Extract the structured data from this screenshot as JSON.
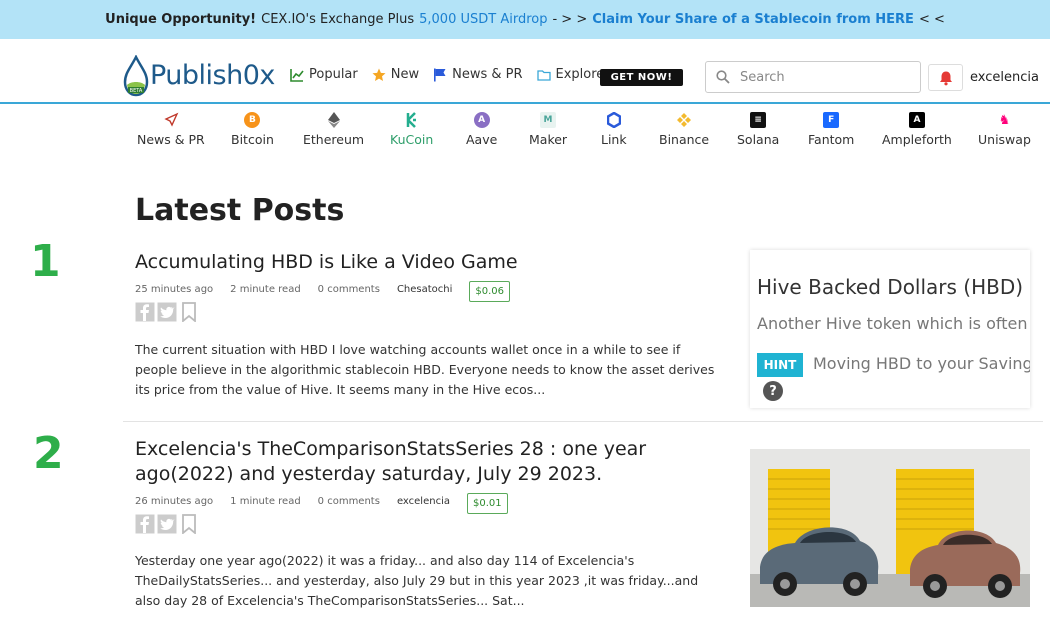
{
  "banner": {
    "bold": "Unique Opportunity!",
    "text": "CEX.IO's Exchange Plus",
    "highlight": "5,000 USDT Airdrop",
    "arrows": "- > >",
    "cta": "Claim Your Share of a Stablecoin from HERE",
    "end": "< <"
  },
  "header": {
    "logo": "Publish0x",
    "nav": [
      {
        "label": "Popular",
        "icon": "chart-icon"
      },
      {
        "label": "New",
        "icon": "star-icon"
      },
      {
        "label": "News & PR",
        "icon": "flag-icon"
      },
      {
        "label": "Explore",
        "icon": "folder-icon"
      }
    ],
    "get_now": "GET NOW!",
    "search_placeholder": "Search",
    "username": "excelencia"
  },
  "coins": [
    {
      "label": "News & PR",
      "color": "#c0392b"
    },
    {
      "label": "Bitcoin",
      "color": "#f7931a"
    },
    {
      "label": "Ethereum",
      "color": "#444444"
    },
    {
      "label": "KuCoin",
      "color": "#24ae8f"
    },
    {
      "label": "Aave",
      "color": "#8a6fc4"
    },
    {
      "label": "Maker",
      "color": "#cfe6e0"
    },
    {
      "label": "Link",
      "color": "#2a5ada"
    },
    {
      "label": "Binance",
      "color": "#f3ba2f"
    },
    {
      "label": "Solana",
      "color": "#111111"
    },
    {
      "label": "Fantom",
      "color": "#1969ff"
    },
    {
      "label": "Ampleforth",
      "color": "#000000"
    },
    {
      "label": "Uniswap",
      "color": "#ff007a"
    }
  ],
  "active_coin": "KuCoin",
  "heading": "Latest Posts",
  "numbers": [
    "1",
    "2"
  ],
  "posts": [
    {
      "title": "Accumulating HBD is Like a Video Game",
      "time": "25 minutes ago",
      "read": "2 minute read",
      "comments": "0 comments",
      "author": "Chesatochi",
      "tip": "$0.06",
      "excerpt": "The current situation with HBD I love watching accounts wallet once in a while to see if people believe in the algorithmic stablecoin HBD. Everyone needs to know the asset derives its price from the value of Hive. It seems many in the Hive ecos...",
      "thumb": {
        "title": "Hive Backed Dollars (HBD)",
        "subtitle": "Another Hive token which is often",
        "hint": "HINT",
        "hint_text": "Moving HBD to your Saving",
        "q": "?"
      }
    },
    {
      "title": "Excelencia's TheComparisonStatsSeries 28 : one year ago(2022) and yesterday saturday, July 29 2023.",
      "time": "26 minutes ago",
      "read": "1 minute read",
      "comments": "0 comments",
      "author": "excelencia",
      "tip": "$0.01",
      "excerpt": "Yesterday one year ago(2022) it was a friday...  and also  day 114 of Excelencia's TheDailyStatsSeries...            and yesterday, also July 29  but in this year 2023 ,it was friday...and also day 28 of Excelencia's TheComparisonStatsSeries...  Sat..."
    }
  ]
}
